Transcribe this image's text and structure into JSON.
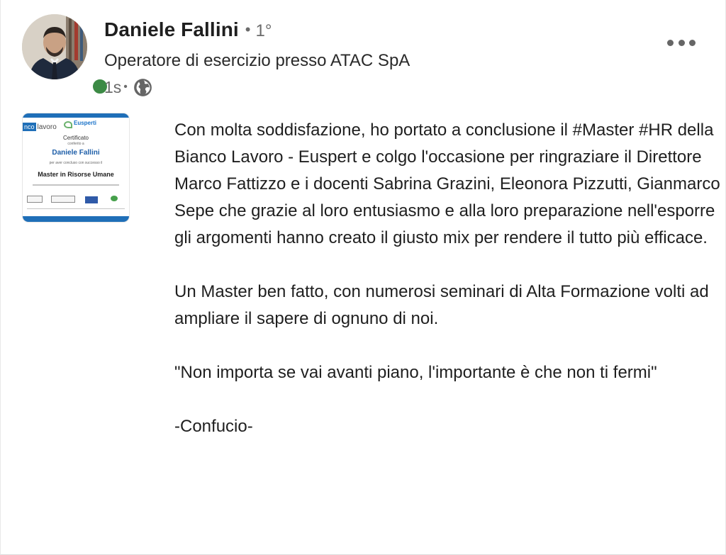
{
  "author": {
    "name": "Daniele Fallini",
    "degree": "1°",
    "headline": "Operatore di esercizio presso ATAC SpA",
    "time": "1s",
    "avatar_icon": "profile-photo",
    "status_color": "#3c8a45"
  },
  "menu": {
    "icon": "more-options-icon"
  },
  "attachment": {
    "logo_text_box": "nco",
    "logo_text_rest": "lavoro",
    "logo_secondary": "Eusperti",
    "title": "Certificato",
    "conferred": "conferito a",
    "recipient": "Daniele Fallini",
    "for_text": "per aver concluso con successo il",
    "course": "Master in Risorse Umane",
    "badge_text": "eipass",
    "accent_color": "#1f6fb8"
  },
  "post": {
    "paragraphs": [
      "Con molta soddisfazione, ho portato a conclusione il #Master #HR della Bianco Lavoro - Euspert e colgo l'occasione per ringraziare il Direttore Marco Fattizzo e i docenti Sabrina Grazini, Eleonora Pizzutti, Gianmarco Sepe che grazie al loro entusiasmo e alla loro preparazione nell'esporre gli argomenti hanno creato il giusto mix per rendere il tutto più efficace.",
      "Un Master ben fatto, con numerosi seminari di Alta Formazione volti ad ampliare il sapere di ognuno di noi.",
      "\"Non importa se vai avanti piano, l'importante è che non ti fermi\"",
      "-Confucio-"
    ]
  }
}
